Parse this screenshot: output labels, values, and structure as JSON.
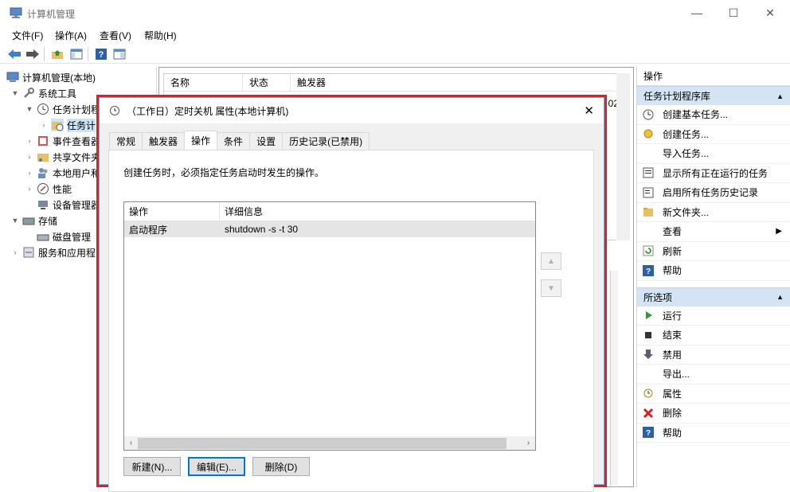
{
  "window": {
    "title": "计算机管理"
  },
  "menu": [
    "文件(F)",
    "操作(A)",
    "查看(V)",
    "帮助(H)"
  ],
  "tree": {
    "root": "计算机管理(本地)",
    "system_tools": "系统工具",
    "task_scheduler": "任务计划程",
    "task_lib": "任务计",
    "event_viewer": "事件查看器",
    "shared": "共享文件夹",
    "local_users": "本地用户和",
    "performance": "性能",
    "device_mgr": "设备管理器",
    "storage": "存储",
    "disk_mgr": "磁盘管理",
    "services": "服务和应用程"
  },
  "center": {
    "col_name": "名称",
    "col_status": "状态",
    "col_trigger": "触发器",
    "peek": "02"
  },
  "right": {
    "header": "操作",
    "section1": "任务计划程序库",
    "actions1": [
      "创建基本任务...",
      "创建任务...",
      "导入任务...",
      "显示所有正在运行的任务",
      "启用所有任务历史记录",
      "新文件夹...",
      "查看",
      "刷新",
      "帮助"
    ],
    "section2": "所选项",
    "actions2": [
      "运行",
      "结束",
      "禁用",
      "导出...",
      "属性",
      "删除",
      "帮助"
    ]
  },
  "dialog": {
    "title": "（工作日）定时关机 属性(本地计算机)",
    "tabs": [
      "常规",
      "触发器",
      "操作",
      "条件",
      "设置",
      "历史记录(已禁用)"
    ],
    "description": "创建任务时，必须指定任务启动时发生的操作。",
    "list_cols": [
      "操作",
      "详细信息"
    ],
    "rows": [
      {
        "action": "启动程序",
        "detail": "shutdown -s -t 30"
      }
    ],
    "btn_new": "新建(N)...",
    "btn_edit": "编辑(E)...",
    "btn_delete": "删除(D)"
  },
  "colors": {
    "highlight": "#e02020",
    "section_bg": "#d4e4f5"
  }
}
